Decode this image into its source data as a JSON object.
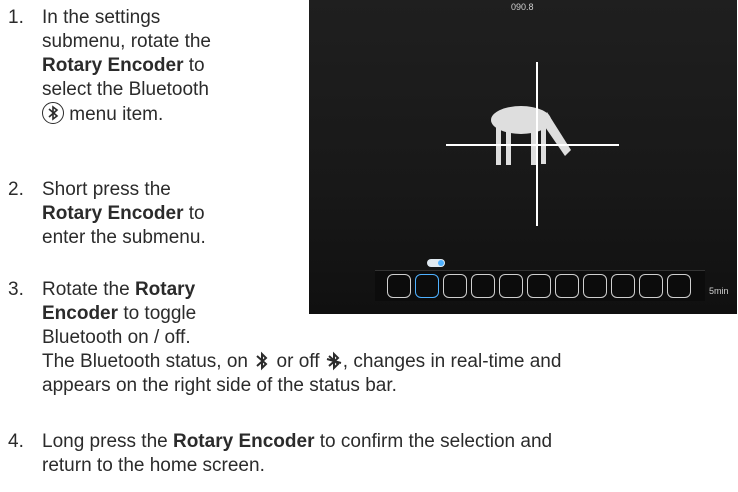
{
  "steps": [
    {
      "number": "1.",
      "lines": [
        "In the settings",
        "submenu, rotate the"
      ],
      "bold": "Rotary Encoder",
      "after_bold": "to",
      "line4": "select the Bluetooth",
      "line5": "menu item."
    },
    {
      "number": "2.",
      "line1": "Short press the",
      "bold": "Rotary Encoder",
      "after_bold": "to",
      "line3": "enter the submenu."
    },
    {
      "number": "3.",
      "line1_pre": "Rotate the",
      "bold1": "Rotary",
      "bold2": "Encoder",
      "line2_post": "to toggle",
      "line3": "Bluetooth on / off.",
      "note_pre": "The Bluetooth status, on",
      "note_mid": "or off",
      "note_post": ", changes in real-time and",
      "note_line2": "appears on the right side of the status bar."
    },
    {
      "number": "4.",
      "pre": "Long press the",
      "bold": "Rotary Encoder",
      "post": "to confirm the selection and",
      "line2": "return to the home screen."
    }
  ],
  "screen": {
    "top_readout": "090.8",
    "time_label": "5min",
    "icons": [
      "grid-icon",
      "bluetooth-icon",
      "landscape-icon",
      "clock-icon",
      "compass-icon",
      "target-icon",
      "brightness-icon",
      "percent-icon",
      "contrast-icon",
      "record-icon",
      "info-icon"
    ]
  }
}
